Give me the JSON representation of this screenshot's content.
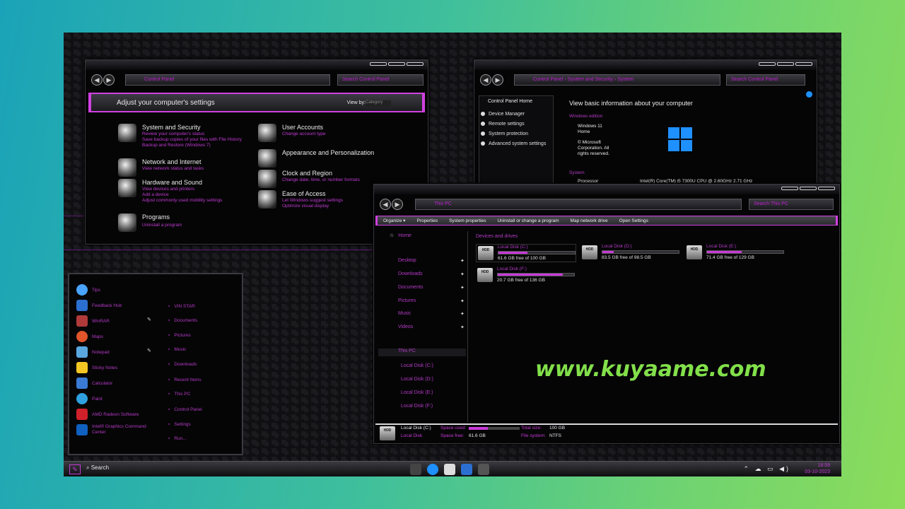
{
  "control_panel": {
    "address": "Control Panel",
    "search": "Search Control Panel",
    "header_title": "Adjust your computer's settings",
    "view_by_label": "View by:",
    "view_by_value": "Category",
    "categories": [
      {
        "title": "System and Security",
        "links": [
          "Review your computer's status",
          "Save backup copies of your files with File History",
          "Backup and Restore (Windows 7)"
        ]
      },
      {
        "title": "Network and Internet",
        "links": [
          "View network status and tasks"
        ]
      },
      {
        "title": "Hardware and Sound",
        "links": [
          "View devices and printers",
          "Add a device",
          "Adjust commonly used mobility settings"
        ]
      },
      {
        "title": "Programs",
        "links": [
          "Uninstall a program"
        ]
      },
      {
        "title": "User Accounts",
        "links": [
          "Change account type"
        ]
      },
      {
        "title": "Appearance and Personalization",
        "links": []
      },
      {
        "title": "Clock and Region",
        "links": [
          "Change date, time, or number formats"
        ]
      },
      {
        "title": "Ease of Access",
        "links": [
          "Let Windows suggest settings",
          "Optimize visual display"
        ]
      }
    ]
  },
  "system_window": {
    "breadcrumb": [
      "Control Panel",
      "System and Security",
      "System"
    ],
    "search": "Search Control Panel",
    "side_home": "Control Panel Home",
    "side_links": [
      "Device Manager",
      "Remote settings",
      "System protection",
      "Advanced system settings"
    ],
    "heading": "View basic information about your computer",
    "edition_label": "Windows edition",
    "edition_lines": [
      "Windows 11",
      "Home"
    ],
    "copyright_lines": [
      "© Microsoft",
      "Corporation. All",
      "rights reserved."
    ],
    "system_label": "System",
    "processor_label": "Processor",
    "processor_value": "Intel(R) Core(TM) i5 7300U CPU @ 2.60GHz  2.71 GHz"
  },
  "explorer": {
    "address": "This PC",
    "search": "Search This PC",
    "toolbar": [
      "Organize ▾",
      "Properties",
      "System properties",
      "Uninstall or change a program",
      "Map network drive",
      "Open Settings"
    ],
    "nav_home": "Home",
    "quick_access": [
      "Desktop",
      "Downloads",
      "Documents",
      "Pictures",
      "Music",
      "Videos"
    ],
    "this_pc": "This PC",
    "this_pc_drives": [
      "Local Disk (C:)",
      "Local Disk (D:)",
      "Local Disk (E:)",
      "Local Disk (F:)"
    ],
    "group_title": "Devices and drives",
    "drives": [
      {
        "name": "Local Disk (C:)",
        "free": "61.6 GB free of 100 GB",
        "used_fraction": 0.38
      },
      {
        "name": "Local Disk (D:)",
        "free": "83.5 GB free of 98.5 GB",
        "used_fraction": 0.15
      },
      {
        "name": "Local Disk (E:)",
        "free": "71.4 GB free of 129 GB",
        "used_fraction": 0.45
      },
      {
        "name": "Local Disk (F:)",
        "free": "20.7 GB free of 136 GB",
        "used_fraction": 0.85
      }
    ],
    "details": {
      "name": "Local Disk (C:)",
      "space_used_label": "Space used:",
      "total_label": "Total size:",
      "total_value": "100 GB",
      "type_label": "Local Disk",
      "free_label": "Space free:",
      "free_value": "61.6 GB",
      "fs_label": "File system:",
      "fs_value": "NTFS"
    }
  },
  "start_menu": {
    "apps": [
      "Tips",
      "Feedback Hub",
      "WinRAR",
      "Maps",
      "Notepad",
      "Sticky Notes",
      "Calculator",
      "Paint",
      "AMD Radeon Software",
      "Intel® Graphics Command Center"
    ],
    "right_links": [
      "VIN STAR",
      "Documents",
      "Pictures",
      "Music",
      "Downloads",
      "Recent Items",
      "This PC",
      "Control Panel",
      "Settings",
      "Run..."
    ]
  },
  "taskbar": {
    "search": "Search",
    "time": "18:59",
    "date": "03-10-2023"
  },
  "watermark": "www.kuyaame.com",
  "colors": {
    "accent": "#c83ad8",
    "watermark": "#82e04a",
    "background": "#101013"
  }
}
